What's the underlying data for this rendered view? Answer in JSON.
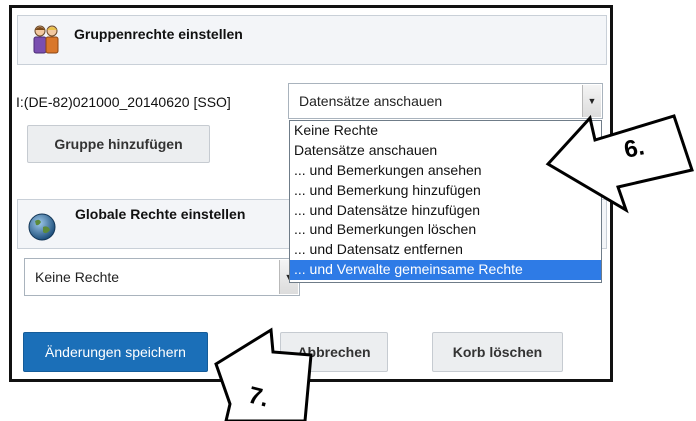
{
  "group_section": {
    "title": "Gruppenrechte einstellen",
    "icon": "users-group-icon"
  },
  "group_row": {
    "label": "I:(DE-82)021000_20140620 [SSO]",
    "selected": "Datensätze anschauen"
  },
  "dropdown": {
    "options": [
      "Keine Rechte",
      "Datensätze anschauen",
      "... und Bemerkungen ansehen",
      "... und Bemerkung hinzufügen",
      "... und Datensätze hinzufügen",
      "... und Bemerkungen löschen",
      "... und Datensatz entfernen",
      "... und Verwalte gemeinsame Rechte"
    ],
    "highlighted_index": 7
  },
  "add_group_button": "Gruppe hinzufügen",
  "global_section": {
    "title": "Globale Rechte einstellen",
    "icon": "globe-icon"
  },
  "global_select": {
    "selected": "Keine Rechte"
  },
  "buttons": {
    "save": "Änderungen speichern",
    "cancel": "Abbrechen",
    "delete_basket": "Korb löschen"
  },
  "callouts": {
    "step6": "6.",
    "step7": "7."
  },
  "colors": {
    "primary_button": "#1b6fb8",
    "highlight": "#2e7be6"
  }
}
